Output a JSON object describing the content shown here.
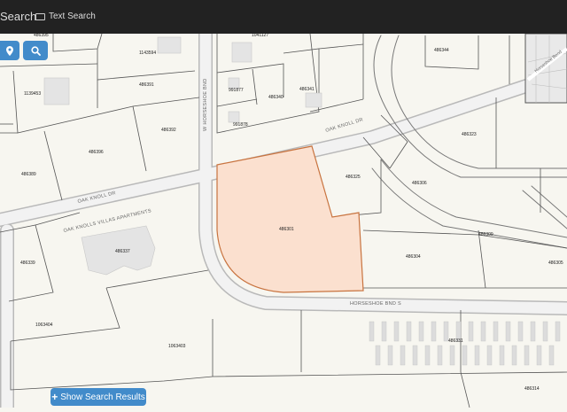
{
  "app": {
    "brand_partial": "Search",
    "text_search_label": "Text Search"
  },
  "buttons": {
    "show_results_label": "Show Search Results"
  },
  "map": {
    "selected_parcel": "486301",
    "highlight_color": "#fbe0cf",
    "highlight_outline": "#c8733f",
    "street_names": {
      "oak_knoll_dr_east": "OAK KNOLL DR",
      "oak_knoll_dr_west": "OAK KNOLL DR",
      "horseshoe_bnd_w": "W HORSESHOE BND",
      "horseshoe_bnd_s": "HORSESHOE BND S",
      "apartments": "OAK KNOLLS VILLAS APARTMENTS",
      "minimap_label": "Horseshoe Bend"
    },
    "parcels": {
      "p486395": "486395",
      "p1143594": "1143594",
      "p1139453": "1139453",
      "p486391": "486391",
      "p486392": "486392",
      "p486396": "486396",
      "p486389": "486389",
      "p486339": "486339",
      "p486337": "486337",
      "p1063404": "1063404",
      "p1063403": "1063403",
      "p1041127": "1041127",
      "p486343": "486343",
      "p486344": "486344",
      "p486352": "486352",
      "p991877": "991877",
      "p486340": "486340",
      "p486341": "486341",
      "p991878": "991878",
      "p486323": "486323",
      "p486325": "486325",
      "p486306": "486306",
      "p486301": "486301",
      "p486309": "486309",
      "p486304": "486304",
      "p486305": "486305",
      "p486331": "486331",
      "p486314": "486314"
    }
  }
}
